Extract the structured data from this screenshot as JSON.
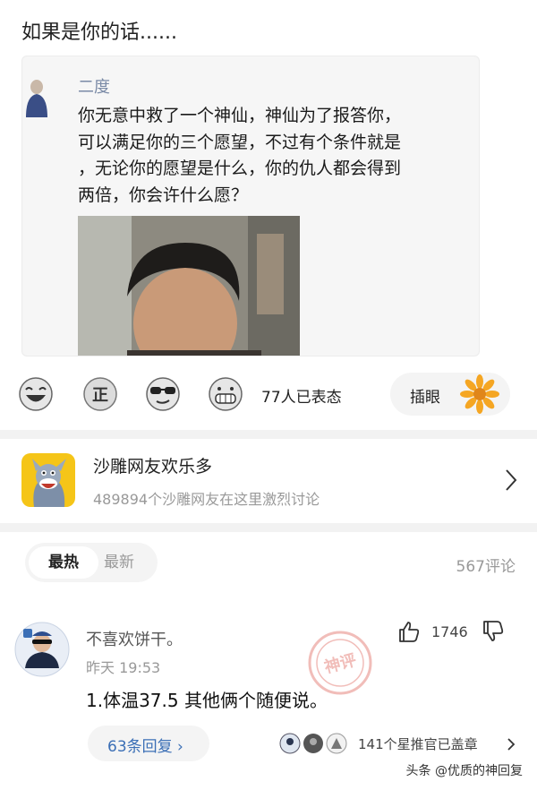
{
  "post": {
    "title": "如果是你的话......"
  },
  "quote": {
    "author": "二度",
    "question_lines": [
      "你无意中救了一个神仙，神仙为了报答你，",
      "可以满足你的三个愿望，不过有个条件就是",
      "，无论你的愿望是什么，你的仇人都会得到",
      "两倍，你会许什么愿？"
    ]
  },
  "reactions": {
    "icons": [
      "laughing-emoji-icon",
      "zheng-emoji-icon",
      "sunglasses-emoji-icon",
      "grinning-emoji-icon"
    ],
    "count_text": "77人已表态",
    "chame_label": "插眼",
    "chame_icon": "sunflower-icon"
  },
  "group": {
    "name": "沙雕网友欢乐多",
    "description": "489894个沙雕网友在这里激烈讨论"
  },
  "comments_header": {
    "tab_hot": "最热",
    "tab_new": "最新",
    "count": "567评论"
  },
  "comment": {
    "username": "不喜欢饼干。",
    "time": "昨天 19:53",
    "text": "1.体温37.5   其他俩个随便说。",
    "likes": "1746",
    "stamp_text": "神评",
    "reply_label": "63条回复 ›",
    "badge_text": "141个星推官已盖章"
  },
  "watermark": "头条 @优质的神回复",
  "colors": {
    "accent_blue": "#3b6fb6",
    "stamp_red": "#d9453a",
    "sunflower": "#f5a623"
  }
}
